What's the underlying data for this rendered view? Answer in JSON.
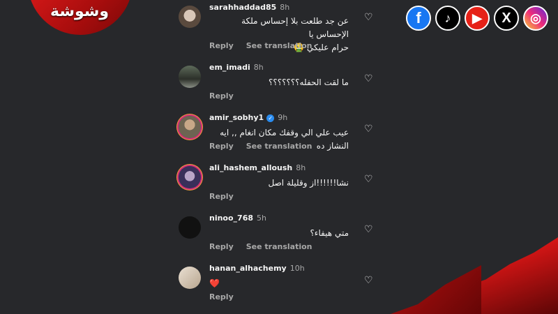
{
  "brand": {
    "logo_text": "وشوشة"
  },
  "socials": [
    {
      "name": "facebook",
      "glyph": "f"
    },
    {
      "name": "tiktok",
      "glyph": "♪"
    },
    {
      "name": "youtube",
      "glyph": "▶"
    },
    {
      "name": "x",
      "glyph": "X"
    },
    {
      "name": "instagram",
      "glyph": "◎"
    }
  ],
  "comments": [
    {
      "username": "sarahhaddad85",
      "time": "8h",
      "text_lines": [
        "عن جد طلعت بلا إحساس ملكة الإحساس يا",
        "حرام عليكي 🤮"
      ],
      "reply": "Reply",
      "translate": "See translation"
    },
    {
      "username": "em_imadi",
      "time": "8h",
      "text_lines": [
        "ما لقت الحفله؟؟؟؟؟؟؟"
      ],
      "reply": "Reply",
      "translate": ""
    },
    {
      "username": "amir_sobhy1",
      "time": "9h",
      "verified": true,
      "text_lines": [
        "عيب علي الي وقفك مكان انغام ,, ايه النشاز ده"
      ],
      "reply": "Reply",
      "translate": "See translation"
    },
    {
      "username": "ali_hashem_alloush",
      "time": "8h",
      "text_lines": [
        "نشا!!!!!!از وقليلة اصل"
      ],
      "reply": "Reply",
      "translate": ""
    },
    {
      "username": "ninoo_768",
      "time": "5h",
      "text_lines": [
        "متي هيفاء؟"
      ],
      "reply": "Reply",
      "translate": "See translation"
    },
    {
      "username": "hanan_alhachemy",
      "time": "10h",
      "text_lines": [
        "❤️"
      ],
      "reply": "Reply",
      "translate": ""
    }
  ]
}
